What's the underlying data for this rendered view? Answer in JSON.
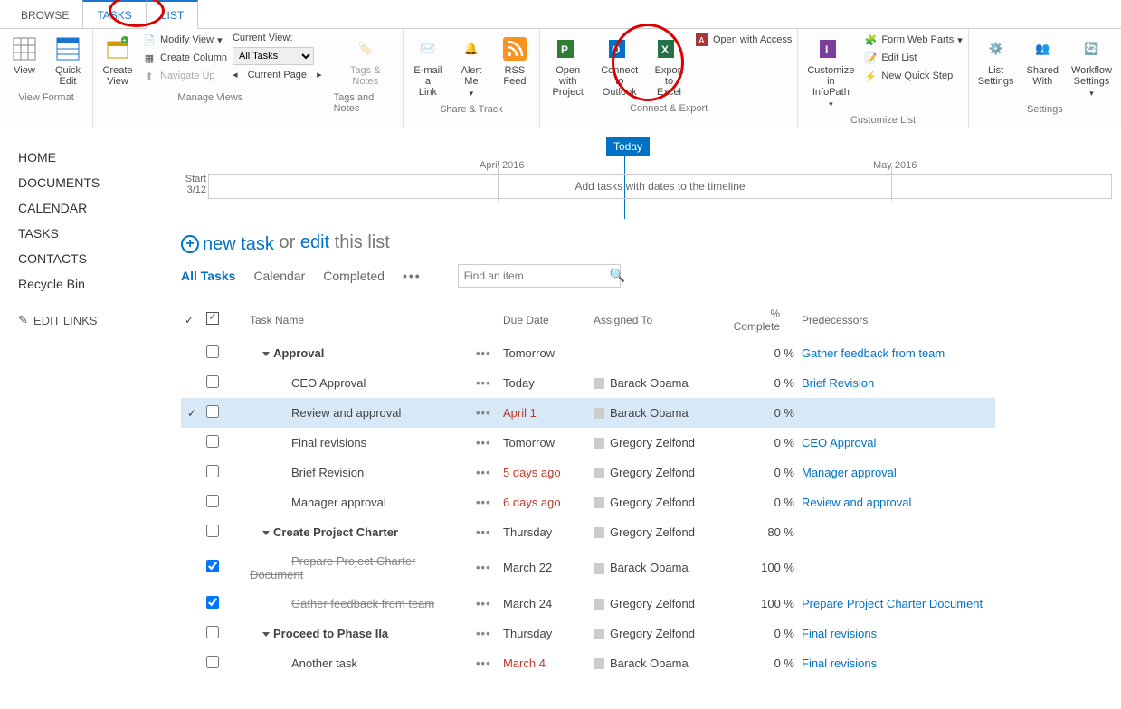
{
  "tabs": {
    "browse": "BROWSE",
    "tasks": "TASKS",
    "list": "LIST"
  },
  "ribbon": {
    "view": "View",
    "quick_edit": "Quick\nEdit",
    "create_view": "Create\nView",
    "modify_view": "Modify View",
    "create_column": "Create Column",
    "navigate_up": "Navigate Up",
    "current_view_lbl": "Current View:",
    "current_view_val": "All Tasks",
    "current_page": "Current Page",
    "tags_notes": "Tags &\nNotes",
    "email_link": "E-mail a\nLink",
    "alert_me": "Alert\nMe",
    "rss": "RSS\nFeed",
    "open_project": "Open with\nProject",
    "connect_outlook": "Connect to\nOutlook",
    "export_excel": "Export to\nExcel",
    "open_access": "Open with Access",
    "customize_infopath": "Customize in\nInfoPath",
    "form_web_parts": "Form Web Parts",
    "edit_list": "Edit List",
    "new_quick_step": "New Quick Step",
    "list_settings": "List\nSettings",
    "shared_with": "Shared\nWith",
    "workflow_settings": "Workflow\nSettings",
    "groups": {
      "view_format": "View Format",
      "manage_views": "Manage Views",
      "tags_notes": "Tags and Notes",
      "share_track": "Share & Track",
      "connect_export": "Connect & Export",
      "customize_list": "Customize List",
      "settings": "Settings"
    }
  },
  "leftnav": {
    "home": "HOME",
    "documents": "DOCUMENTS",
    "calendar": "CALENDAR",
    "tasks": "TASKS",
    "contacts": "CONTACTS",
    "recycle": "Recycle Bin",
    "edit_links": "EDIT LINKS"
  },
  "timeline": {
    "today": "Today",
    "month1": "April 2016",
    "month2": "May 2016",
    "start_lbl": "Start",
    "start_date": "3/12",
    "placeholder": "Add tasks with dates to the timeline"
  },
  "newtask": {
    "new": "new task",
    "or": "or",
    "edit": "edit",
    "rest": "this list"
  },
  "view_tabs": {
    "all": "All Tasks",
    "calendar": "Calendar",
    "completed": "Completed"
  },
  "search_placeholder": "Find an item",
  "columns": {
    "task": "Task Name",
    "due": "Due Date",
    "assigned": "Assigned To",
    "pct": "% Complete",
    "pred": "Predecessors"
  },
  "rows": [
    {
      "sel": false,
      "chk": false,
      "done": false,
      "indent": 1,
      "group": true,
      "name": "Approval",
      "due": "Tomorrow",
      "overdue": false,
      "assigned": "",
      "pct": "0 %",
      "pred": "Gather feedback from team"
    },
    {
      "sel": false,
      "chk": false,
      "done": false,
      "indent": 2,
      "group": false,
      "name": "CEO Approval",
      "due": "Today",
      "overdue": false,
      "assigned": "Barack Obama",
      "pct": "0 %",
      "pred": "Brief Revision"
    },
    {
      "sel": true,
      "chk": false,
      "done": false,
      "indent": 2,
      "group": false,
      "name": "Review and approval",
      "due": "April 1",
      "overdue": true,
      "assigned": "Barack Obama",
      "pct": "0 %",
      "pred": ""
    },
    {
      "sel": false,
      "chk": false,
      "done": false,
      "indent": 2,
      "group": false,
      "name": "Final revisions",
      "due": "Tomorrow",
      "overdue": false,
      "assigned": "Gregory Zelfond",
      "pct": "0 %",
      "pred": "CEO Approval"
    },
    {
      "sel": false,
      "chk": false,
      "done": false,
      "indent": 2,
      "group": false,
      "name": "Brief Revision",
      "due": "5 days ago",
      "overdue": true,
      "assigned": "Gregory Zelfond",
      "pct": "0 %",
      "pred": "Manager approval"
    },
    {
      "sel": false,
      "chk": false,
      "done": false,
      "indent": 2,
      "group": false,
      "name": "Manager approval",
      "due": "6 days ago",
      "overdue": true,
      "assigned": "Gregory Zelfond",
      "pct": "0 %",
      "pred": "Review and approval"
    },
    {
      "sel": false,
      "chk": false,
      "done": false,
      "indent": 1,
      "group": true,
      "name": "Create Project Charter",
      "due": "Thursday",
      "overdue": false,
      "assigned": "Gregory Zelfond",
      "pct": "80 %",
      "pred": ""
    },
    {
      "sel": false,
      "chk": true,
      "done": true,
      "indent": 2,
      "group": false,
      "name": "Prepare Project Charter Document",
      "due": "March 22",
      "overdue": false,
      "assigned": "Barack Obama",
      "pct": "100 %",
      "pred": ""
    },
    {
      "sel": false,
      "chk": true,
      "done": true,
      "indent": 2,
      "group": false,
      "name": "Gather feedback from team",
      "due": "March 24",
      "overdue": false,
      "assigned": "Gregory Zelfond",
      "pct": "100 %",
      "pred": "Prepare Project Charter Document"
    },
    {
      "sel": false,
      "chk": false,
      "done": false,
      "indent": 1,
      "group": true,
      "name": "Proceed to Phase IIa",
      "due": "Thursday",
      "overdue": false,
      "assigned": "Gregory Zelfond",
      "pct": "0 %",
      "pred": "Final revisions"
    },
    {
      "sel": false,
      "chk": false,
      "done": false,
      "indent": 2,
      "group": false,
      "name": "Another task",
      "due": "March 4",
      "overdue": true,
      "assigned": "Barack Obama",
      "pct": "0 %",
      "pred": "Final revisions"
    }
  ]
}
